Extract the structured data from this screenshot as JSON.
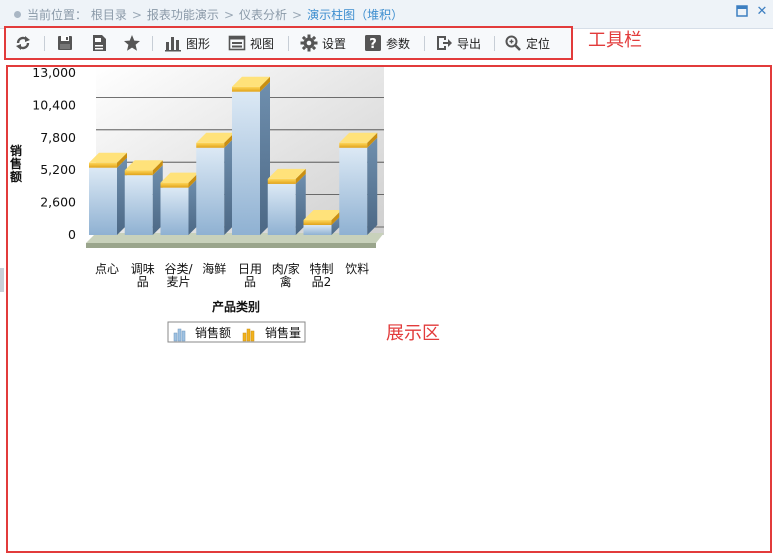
{
  "breadcrumb": {
    "prefix": "当前位置：",
    "items": [
      "根目录",
      "报表功能演示",
      "仪表分析"
    ],
    "separator": ">",
    "current": "演示柱图（堆积）"
  },
  "window": {
    "restore_icon": "window-restore-icon",
    "close_icon": "close-icon",
    "close_label": "✕"
  },
  "toolbar": {
    "annotation": "工具栏",
    "buttons": [
      {
        "id": "refresh",
        "icon": "refresh-icon",
        "label": ""
      },
      {
        "id": "save",
        "icon": "save-icon",
        "label": ""
      },
      {
        "id": "save-as",
        "icon": "document-icon",
        "label": ""
      },
      {
        "id": "favorite",
        "icon": "star-icon",
        "label": ""
      },
      {
        "id": "chart",
        "icon": "bar-chart-icon",
        "label": "图形"
      },
      {
        "id": "view",
        "icon": "view-icon",
        "label": "视图"
      },
      {
        "id": "settings",
        "icon": "gear-icon",
        "label": "设置"
      },
      {
        "id": "params",
        "icon": "question-icon",
        "label": "参数"
      },
      {
        "id": "export",
        "icon": "export-icon",
        "label": "导出"
      },
      {
        "id": "locate",
        "icon": "search-icon",
        "label": "定位"
      }
    ]
  },
  "display": {
    "annotation": "展示区"
  },
  "colors": {
    "accent": "#e23b3b",
    "link": "#3d8ecf",
    "bar": "#a9c7e2",
    "cap": "#f2b21c"
  },
  "chart_data": {
    "type": "bar",
    "style": "3d-stacked",
    "categories": [
      "点心",
      "调味品",
      "谷类/麦片",
      "海鲜",
      "日用品",
      "肉/家禽",
      "特制品2",
      "饮料"
    ],
    "category_lines": [
      [
        "点心"
      ],
      [
        "调味",
        "品"
      ],
      [
        "谷类/",
        "麦片"
      ],
      [
        "海鲜"
      ],
      [
        "日用",
        "品"
      ],
      [
        "肉/家",
        "禽"
      ],
      [
        "特制",
        "品2"
      ],
      [
        "饮料"
      ]
    ],
    "series": [
      {
        "name": "销售额",
        "values": [
          5400,
          4800,
          3800,
          7000,
          11500,
          4100,
          800,
          7000
        ]
      },
      {
        "name": "销售量",
        "values": [
          400,
          400,
          400,
          400,
          400,
          400,
          400,
          400
        ]
      }
    ],
    "xlabel": "产品类别",
    "ylabel": "销售额",
    "ylim": [
      0,
      13000
    ],
    "yticks": [
      "13,000",
      "10,400",
      "7,800",
      "5,200",
      "2,600",
      "0"
    ],
    "ytick_values": [
      13000,
      10400,
      7800,
      5200,
      2600,
      0
    ],
    "grid": true,
    "legend_position": "bottom"
  }
}
